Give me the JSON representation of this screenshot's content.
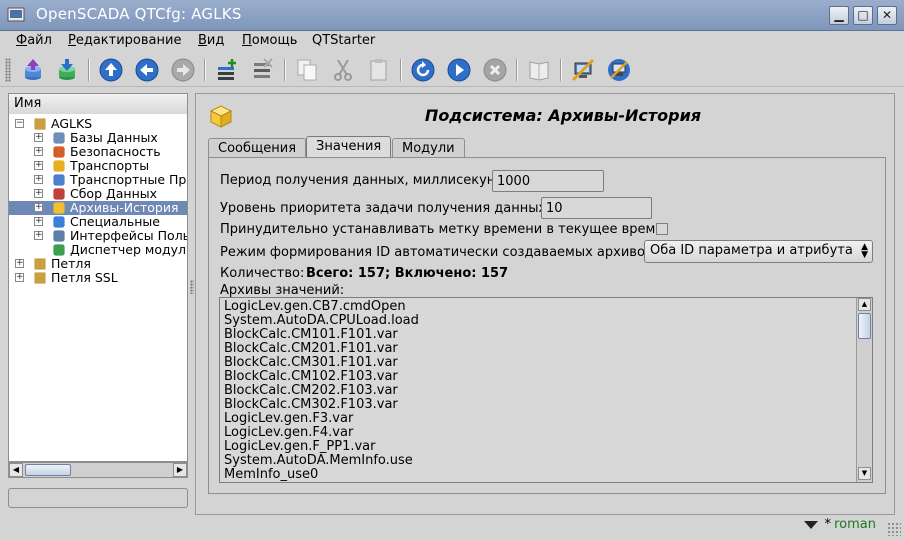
{
  "window": {
    "title": "OpenSCADA QTCfg: AGLKS",
    "minimize": "▁",
    "maximize": "□",
    "close": "✕"
  },
  "menu": {
    "items": [
      {
        "first": "Ф",
        "rest": "айл"
      },
      {
        "first": "Р",
        "rest": "едактирование"
      },
      {
        "first": "В",
        "rest": "ид"
      },
      {
        "first": "П",
        "rest": "омощь"
      },
      {
        "first": "",
        "rest": "QTStarter"
      }
    ]
  },
  "toolbar": {
    "icons": [
      "db-load-icon",
      "db-save-icon",
      "up-icon",
      "back-icon",
      "forward-icon",
      "add-icon",
      "delete-icon",
      "copy-icon",
      "cut-icon",
      "paste-icon",
      "refresh-icon",
      "start-icon",
      "stop-icon",
      "manual-icon",
      "station-1-icon",
      "station-2-icon"
    ]
  },
  "tree": {
    "header": "Имя",
    "items": [
      {
        "label": "AGLKS",
        "level": 0,
        "exp": "−",
        "icon": "folder-icon"
      },
      {
        "label": "Базы Данных",
        "level": 1,
        "exp": "+",
        "icon": "database-icon"
      },
      {
        "label": "Безопасность",
        "level": 1,
        "exp": "+",
        "icon": "security-icon"
      },
      {
        "label": "Транспорты",
        "level": 1,
        "exp": "+",
        "icon": "transport-icon"
      },
      {
        "label": "Транспортные Пр",
        "level": 1,
        "exp": "+",
        "icon": "protocol-icon"
      },
      {
        "label": "Сбор Данных",
        "level": 1,
        "exp": "+",
        "icon": "daq-icon"
      },
      {
        "label": "Архивы-История",
        "level": 1,
        "exp": "+",
        "icon": "archive-icon",
        "selected": true
      },
      {
        "label": "Специальные",
        "level": 1,
        "exp": "+",
        "icon": "special-icon"
      },
      {
        "label": "Интерфейсы Поль",
        "level": 1,
        "exp": "+",
        "icon": "ui-icon"
      },
      {
        "label": "Диспетчер модул",
        "level": 1,
        "exp": "",
        "icon": "modules-icon"
      },
      {
        "label": "Петля",
        "level": 0,
        "exp": "+",
        "icon": "folder-icon"
      },
      {
        "label": "Петля SSL",
        "level": 0,
        "exp": "+",
        "icon": "folder-icon"
      }
    ]
  },
  "page": {
    "title": "Подсистема: Архивы-История",
    "tabs": [
      {
        "label": "Сообщения",
        "active": false
      },
      {
        "label": "Значения",
        "active": true
      },
      {
        "label": "Модули",
        "active": false
      }
    ],
    "period_label": "Период получения данных, миллисекунд:",
    "period_value": "1000",
    "priority_label": "Уровень приоритета задачи получения данных:",
    "priority_value": "10",
    "force_time_label": "Принудительно устанавливать метку времени в текущее время:",
    "force_time_checked": false,
    "id_mode_label": "Режим формирования ID автоматически создаваемых архивов:",
    "id_mode_value": "Оба ID параметра и атрибута",
    "count_label": "Количество:",
    "count_value": "Всего: 157; Включено: 157",
    "archives_label": "Архивы значений:",
    "archives": [
      "LogicLev.gen.CB7.cmdOpen",
      "System.AutoDA.CPULoad.load",
      "BlockCalc.CM101.F101.var",
      "BlockCalc.CM201.F101.var",
      "BlockCalc.CM301.F101.var",
      "BlockCalc.CM102.F103.var",
      "BlockCalc.CM202.F103.var",
      "BlockCalc.CM302.F103.var",
      "LogicLev.gen.F3.var",
      "LogicLev.gen.F4.var",
      "LogicLev.gen.F_PP1.var",
      "System.AutoDA.MemInfo.use",
      "MemInfo_use0"
    ]
  },
  "status": {
    "star": "*",
    "user": "roman"
  }
}
